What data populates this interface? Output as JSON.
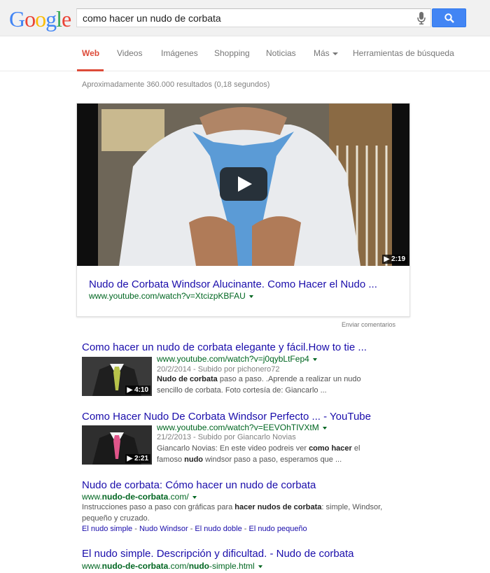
{
  "logo": {
    "letters": [
      "G",
      "o",
      "o",
      "g",
      "l",
      "e"
    ],
    "colors": [
      "#4285f4",
      "#ea4335",
      "#fbbc05",
      "#4285f4",
      "#34a853",
      "#ea4335"
    ]
  },
  "search": {
    "query": "como hacer un nudo de corbata",
    "mic_icon": "microphone-icon",
    "button_icon": "search-icon"
  },
  "tabs": [
    {
      "label": "Web"
    },
    {
      "label": "Videos"
    },
    {
      "label": "Imágenes"
    },
    {
      "label": "Shopping"
    },
    {
      "label": "Noticias"
    },
    {
      "label": "Más"
    },
    {
      "label": "Herramientas de búsqueda"
    }
  ],
  "result_stats": "Aproximadamente 360.000 resultados (0,18 segundos)",
  "featured_video": {
    "duration": "2:19",
    "title": "Nudo de Corbata Windsor Alucinante. Como Hacer el Nudo ...",
    "url": "www.youtube.com/watch?v=XtcizpKBFAU"
  },
  "feedback": "Enviar comentarios",
  "results": [
    {
      "title": "Como hacer un nudo de corbata elegante y fácil.How to tie ...",
      "url": "www.youtube.com/watch?v=j0qybLtFep4",
      "meta": "20/2/2014 - Subido por pichonero72",
      "snippet_bold1": "Nudo de corbata",
      "snippet_rest1": " paso a paso. .Aprende a realizar un nudo",
      "snippet_line2": "sencillo de corbata. Foto cortesía de: Giancarlo ...",
      "duration": "4:10",
      "tie_color": "#b8c34a"
    },
    {
      "title": "Como Hacer Nudo De Corbata Windsor Perfecto ... - YouTube",
      "url": "www.youtube.com/watch?v=EEVOhTIVXtM",
      "meta": "21/2/2013 - Subido por Giancarlo Novias",
      "snippet_a": "Giancarlo Novias: En este video podreis ver ",
      "snippet_b": "como hacer",
      "snippet_c": " el",
      "snippet_d": "famoso ",
      "snippet_e": "nudo",
      "snippet_f": " windsor paso a paso, esperamos que ...",
      "duration": "2:21",
      "tie_color": "#e0558a"
    },
    {
      "title": "Nudo de corbata: Cómo hacer un nudo de corbata",
      "url_a": "www.",
      "url_b": "nudo-de-corbata",
      "url_c": ".com/",
      "snippet_a": "Instrucciones paso a paso con gráficas para ",
      "snippet_b": "hacer nudos de corbata",
      "snippet_c": ": simple, Windsor,",
      "snippet_line2": "pequeño y cruzado.",
      "sitelinks": [
        "El nudo simple",
        "Nudo Windsor",
        "El nudo doble",
        "El nudo pequeño"
      ],
      "sitelink_sep": " - "
    },
    {
      "title": "El nudo simple. Descripción y dificultad. - Nudo de corbata",
      "url_a": "www.",
      "url_b": "nudo-de-corbata",
      "url_c": ".com/",
      "url_d": "nudo",
      "url_e": "-simple.html"
    }
  ]
}
